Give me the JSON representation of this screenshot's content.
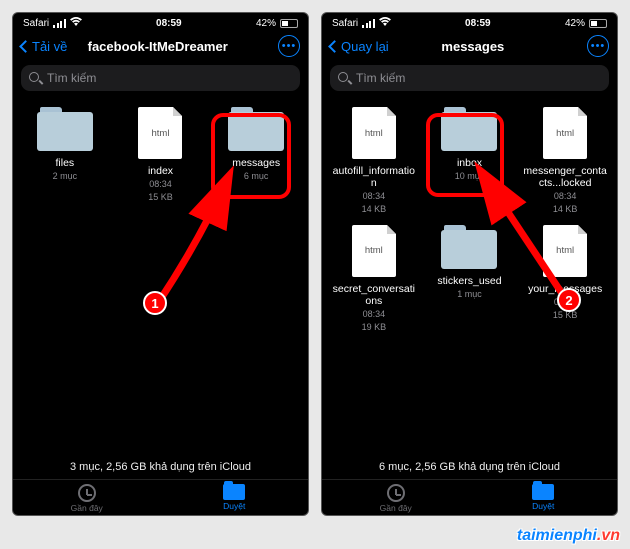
{
  "status": {
    "app": "Safari",
    "time": "08:59",
    "battery_pct": "42%",
    "battery_fill": 42
  },
  "left": {
    "back": "Tải về",
    "title": "facebook-ItMeDreamer",
    "search_placeholder": "Tìm kiếm",
    "items": [
      {
        "type": "folder",
        "name": "files",
        "sub": "2 mục",
        "size": ""
      },
      {
        "type": "file",
        "filetype": "html",
        "name": "index",
        "sub": "08:34",
        "size": "15 KB"
      },
      {
        "type": "folder",
        "name": "messages",
        "sub": "6 mục",
        "size": "",
        "highlight": true
      }
    ],
    "footer": "3 mục, 2,56 GB khả dụng trên iCloud",
    "tabs": {
      "recent": "Gần đây",
      "browse": "Duyệt"
    },
    "badge": "1"
  },
  "right": {
    "back": "Quay lại",
    "title": "messages",
    "search_placeholder": "Tìm kiếm",
    "items": [
      {
        "type": "file",
        "filetype": "html",
        "name": "autofill_information",
        "sub": "08:34",
        "size": "14 KB"
      },
      {
        "type": "folder",
        "name": "inbox",
        "sub": "10 mục",
        "size": "",
        "highlight": true
      },
      {
        "type": "file",
        "filetype": "html",
        "name": "messenger_contacts...locked",
        "sub": "08:34",
        "size": "14 KB"
      },
      {
        "type": "file",
        "filetype": "html",
        "name": "secret_conversations",
        "sub": "08:34",
        "size": "19 KB"
      },
      {
        "type": "folder",
        "name": "stickers_used",
        "sub": "1 mục",
        "size": ""
      },
      {
        "type": "file",
        "filetype": "html",
        "name": "your_messages",
        "sub": "08:34",
        "size": "15 KB"
      }
    ],
    "footer": "6 mục, 2,56 GB khả dụng trên iCloud",
    "tabs": {
      "recent": "Gần đây",
      "browse": "Duyệt"
    },
    "badge": "2"
  },
  "watermark": {
    "a": "taimienphi",
    "b": ".vn"
  }
}
